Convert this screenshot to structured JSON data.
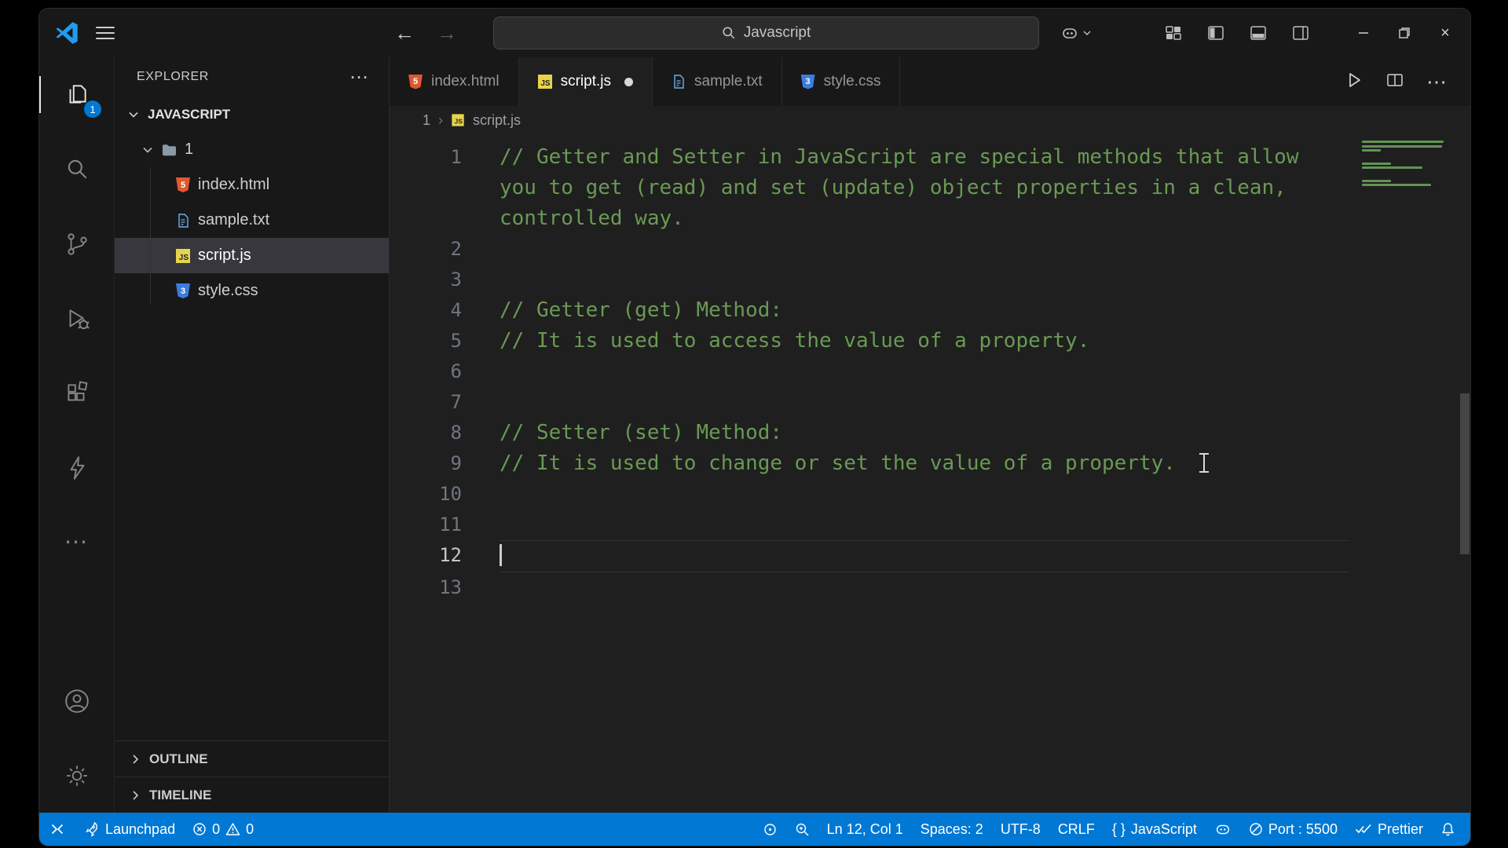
{
  "titlebar": {
    "search_value": "Javascript"
  },
  "activity_bar": {
    "explorer_badge": "1"
  },
  "sidebar": {
    "header": "EXPLORER",
    "section_label": "JAVASCRIPT",
    "folder_label": "1",
    "files": [
      {
        "name": "index.html",
        "icon": "html",
        "selected": false
      },
      {
        "name": "sample.txt",
        "icon": "txt",
        "selected": false
      },
      {
        "name": "script.js",
        "icon": "js",
        "selected": true
      },
      {
        "name": "style.css",
        "icon": "css",
        "selected": false
      }
    ],
    "panels": [
      {
        "label": "OUTLINE"
      },
      {
        "label": "TIMELINE"
      }
    ]
  },
  "tabs": [
    {
      "label": "index.html",
      "icon": "html",
      "active": false,
      "modified": false
    },
    {
      "label": "script.js",
      "icon": "js",
      "active": true,
      "modified": true
    },
    {
      "label": "sample.txt",
      "icon": "txt",
      "active": false,
      "modified": false
    },
    {
      "label": "style.css",
      "icon": "css",
      "active": false,
      "modified": false
    }
  ],
  "breadcrumb": {
    "folder": "1",
    "file": "script.js"
  },
  "editor": {
    "lines": [
      {
        "number": 1,
        "text": "// Getter and Setter in JavaScript are special methods that allow you to get (read) and set (update) object properties in a clean, controlled way.",
        "current": false
      },
      {
        "number": 2,
        "text": "",
        "current": false
      },
      {
        "number": 3,
        "text": "",
        "current": false
      },
      {
        "number": 4,
        "text": "// Getter (get) Method:",
        "current": false
      },
      {
        "number": 5,
        "text": "// It is used to access the value of a property.",
        "current": false
      },
      {
        "number": 6,
        "text": "",
        "current": false
      },
      {
        "number": 7,
        "text": "",
        "current": false
      },
      {
        "number": 8,
        "text": "// Setter (set) Method:",
        "current": false
      },
      {
        "number": 9,
        "text": "// It is used to change or set the value of a property.",
        "current": false
      },
      {
        "number": 10,
        "text": "",
        "current": false
      },
      {
        "number": 11,
        "text": "",
        "current": false
      },
      {
        "number": 12,
        "text": "",
        "current": true
      },
      {
        "number": 13,
        "text": "",
        "current": false
      }
    ]
  },
  "file_icons": {
    "html_badge": "5",
    "css_badge": "3",
    "js_badge": "JS"
  },
  "statusbar": {
    "launchpad_label": "Launchpad",
    "errors": "0",
    "warnings": "0",
    "cursor_position": "Ln 12, Col 1",
    "indentation": "Spaces: 2",
    "encoding": "UTF-8",
    "eol": "CRLF",
    "language_icon": "{ }",
    "language": "JavaScript",
    "port": "Port : 5500",
    "formatter": "Prettier"
  },
  "colors": {
    "accent_blue": "#0078d4",
    "comment_green": "#6A9955",
    "html_orange": "#e0582f",
    "js_yellow": "#e7d44d"
  }
}
